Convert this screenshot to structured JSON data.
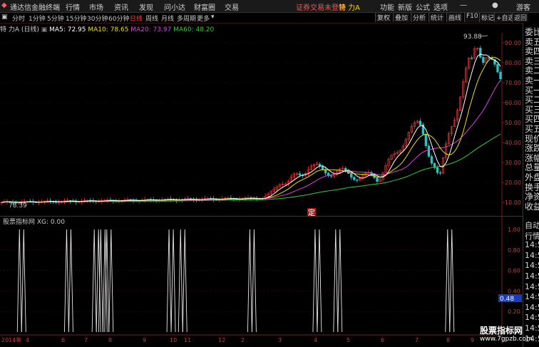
{
  "menu": {
    "app_title": "通达信金融终端",
    "items": [
      "行情",
      "市场",
      "资讯",
      "发现",
      "问小达",
      "财富圈",
      "交易"
    ],
    "notice": "证券交易未登录",
    "stock_name": "特 力A",
    "right_items": [
      "功能",
      "新版",
      "公式",
      "选项"
    ],
    "guest": "游客"
  },
  "toolbar": {
    "periods": [
      "分时",
      "1分钟",
      "5分钟",
      "15分钟",
      "30分钟",
      "60分钟",
      "日线",
      "周线",
      "月线",
      "多周期",
      "更多"
    ],
    "active_period": "日线",
    "right_tools": [
      "复权",
      "叠加",
      "分析",
      "统计",
      "画线",
      "F10",
      "标记",
      "+自选",
      "返回"
    ]
  },
  "info": {
    "stock": "特 力A (日线)",
    "ma5_label": "MA5: 72.95",
    "ma10_label": "MA10: 78.65",
    "ma20_label": "MA20: 73.97",
    "ma60_label": "MA60: 48.20"
  },
  "main_chart": {
    "y_ticks": [
      "90.00",
      "80.00",
      "70.00",
      "60.00",
      "50.00",
      "40.00",
      "30.00",
      "20.00",
      "10.00"
    ],
    "high_label": "93.88",
    "low_label": "78.39",
    "marker": "定"
  },
  "sub_chart": {
    "title": "股票指标网 XG: 0.00",
    "y_ticks": [
      "1.00",
      "0.80",
      "0.60",
      "0.40",
      "0.20"
    ],
    "current_value": "0.48",
    "x_labels": [
      "2014年",
      "4",
      "6",
      "7",
      "8",
      "9",
      "10",
      "11",
      "12",
      "2",
      "3",
      "4",
      "5",
      "6",
      "7",
      "8",
      "9"
    ],
    "signal_positions": [
      0.043,
      0.137,
      0.192,
      0.205,
      0.217,
      0.341,
      0.364,
      0.502,
      0.632,
      0.673,
      0.896
    ]
  },
  "right_panel": {
    "top_labels": [
      "委比",
      "卖五",
      "卖四",
      "卖三",
      "卖二",
      "卖一",
      "买一",
      "买二",
      "买三",
      "买四",
      "买五",
      "现价",
      "涨跌",
      "涨幅",
      "总量",
      "外盘",
      "换手",
      "净资",
      "收益"
    ],
    "bottom_labels": [
      "自动",
      "行情",
      "14:5",
      "14:5",
      "14:5",
      "14:5",
      "14:5",
      "14:5",
      "14:5",
      "14:5",
      "14:5",
      "14:5"
    ]
  },
  "watermark": {
    "title": "股票指标网",
    "url": "www.7gpzb.com"
  },
  "colors": {
    "accent_red": "#7a1c1c",
    "ma5": "#ffffff",
    "ma10": "#f0e000",
    "ma20": "#e040e0",
    "ma60": "#30d030",
    "up_candle": "#ff3030",
    "down_candle": "#30c0c0",
    "active_period": "#ff4040"
  }
}
